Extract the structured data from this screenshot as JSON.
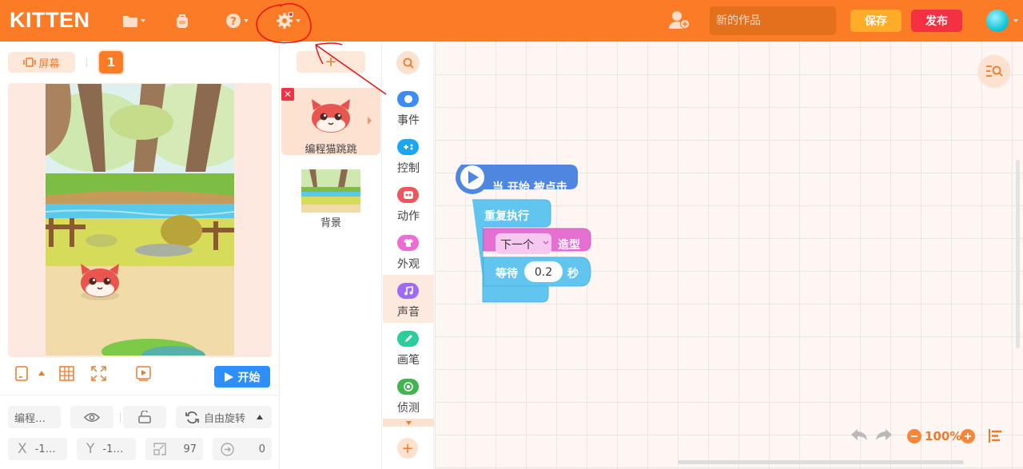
{
  "topbar": {
    "logo": "KITTEN",
    "icons": [
      "folder-icon",
      "backpack-icon",
      "help-icon",
      "settings-icon"
    ],
    "project_placeholder": "新的作品",
    "save_label": "保存",
    "publish_label": "发布",
    "colors": {
      "bar": "#fc7b26",
      "save": "#ffac2a",
      "publish": "#f43142"
    }
  },
  "stage": {
    "screen_label": "屏幕",
    "screen_number": "1",
    "start_label": "开始"
  },
  "sprite_props": {
    "name": "编程…",
    "rotation_label": "自由旋转",
    "x_label": "X",
    "x_value": "-1…",
    "y_label": "Y",
    "y_value": "-1…",
    "size_value": "97",
    "direction_value": "0"
  },
  "sprites": {
    "add_label": "+",
    "items": [
      {
        "name": "编程猫跳跳",
        "selected": true
      }
    ],
    "background_label": "背景"
  },
  "categories": [
    {
      "label": "事件",
      "color": "#3d8df5",
      "icon": "toggle-icon"
    },
    {
      "label": "控制",
      "color": "#1aa6f0",
      "icon": "gamepad-icon"
    },
    {
      "label": "动作",
      "color": "#f2545b",
      "icon": "motion-icon"
    },
    {
      "label": "外观",
      "color": "#ee6bd6",
      "icon": "shirt-icon"
    },
    {
      "label": "声音",
      "color": "#9d6cf2",
      "icon": "music-icon",
      "active": true
    },
    {
      "label": "画笔",
      "color": "#2ccc9d",
      "icon": "pen-icon"
    },
    {
      "label": "侦测",
      "color": "#40b44e",
      "icon": "target-icon"
    }
  ],
  "blocks": {
    "hat_label": "当 开始 被点击",
    "repeat_label": "重复执行",
    "costume_dropdown": "下一个",
    "costume_suffix": "造型",
    "wait_label": "等待",
    "wait_value": "0.2",
    "wait_unit": "秒"
  },
  "workspace": {
    "zoom": "100%"
  }
}
